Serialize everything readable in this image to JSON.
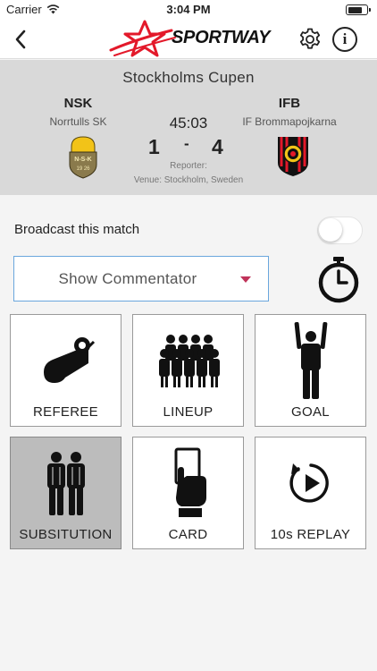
{
  "status": {
    "carrier": "Carrier",
    "time": "3:04 PM",
    "battery_level": 0.75
  },
  "nav": {
    "logo_text": "SPORTWAY",
    "back_icon": "chevron-left-icon",
    "settings_icon": "gear-icon",
    "info_icon": "info-icon",
    "info_glyph": "i"
  },
  "colors": {
    "accent_red": "#e3192a",
    "dropdown_border": "#6aa7dd",
    "dropdown_arrow": "#c0335a",
    "panel_bg": "#d9d9d9"
  },
  "match": {
    "tournament": "Stockholms Cupen",
    "home": {
      "code": "NSK",
      "name": "Norrtulls SK",
      "crest_text": "N-S-K",
      "crest_year": "19 26"
    },
    "away": {
      "code": "IFB",
      "name": "IF Brommapojkarna"
    },
    "clock": "45:03",
    "score_home": "1",
    "score_separator": "-",
    "score_away": "4",
    "reporter": "Reporter:",
    "venue": "Venue: Stockholm, Sweden"
  },
  "broadcast": {
    "label": "Broadcast this match",
    "enabled": false
  },
  "commentator": {
    "selected": "Show Commentator"
  },
  "actions": [
    {
      "label": "REFEREE",
      "icon": "whistle-icon",
      "active": false
    },
    {
      "label": "LINEUP",
      "icon": "team-icon",
      "active": false
    },
    {
      "label": "GOAL",
      "icon": "celebrating-player-icon",
      "active": false
    },
    {
      "label": "SUBSITUTION",
      "icon": "two-players-icon",
      "active": true
    },
    {
      "label": "CARD",
      "icon": "card-hand-icon",
      "active": false
    },
    {
      "label": "10s REPLAY",
      "icon": "replay-icon",
      "active": false
    }
  ]
}
